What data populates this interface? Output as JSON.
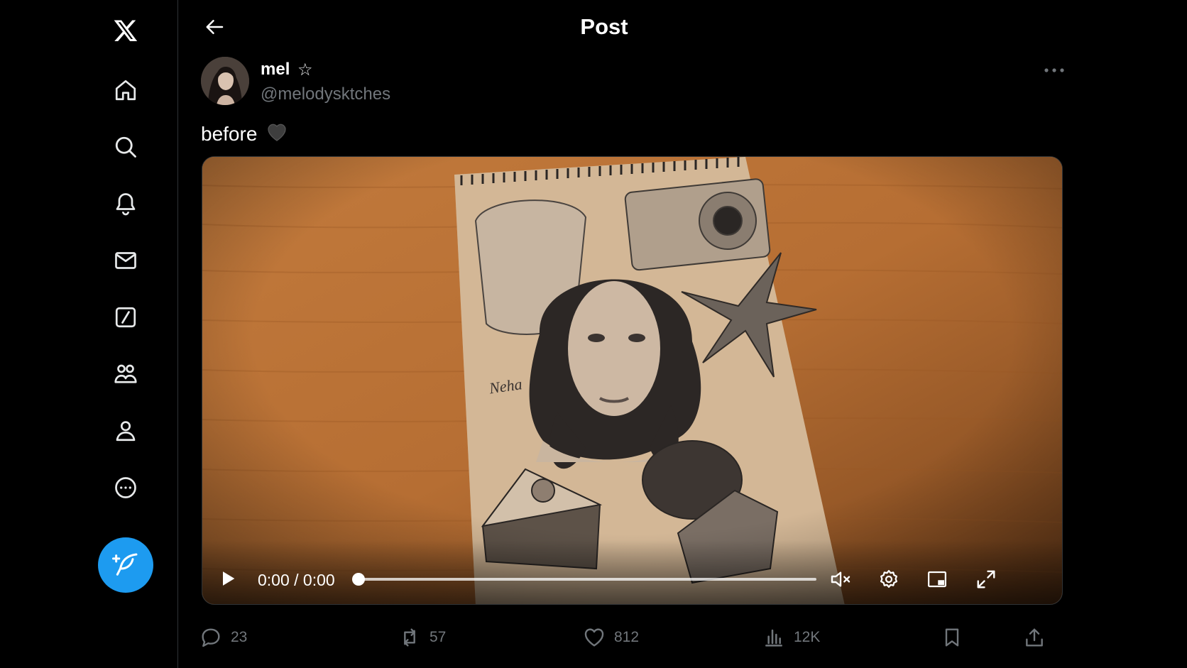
{
  "header": {
    "title": "Post"
  },
  "post": {
    "author": "mel",
    "handle": "@melodysktches",
    "text": "before",
    "video": {
      "time": "0:00 / 0:00",
      "progress": 0
    }
  },
  "actions": {
    "replies": "23",
    "reposts": "57",
    "likes": "812",
    "views": "12K"
  },
  "colors": {
    "accent": "#1d9bf0",
    "background": "#000000",
    "muted": "#71767b"
  }
}
